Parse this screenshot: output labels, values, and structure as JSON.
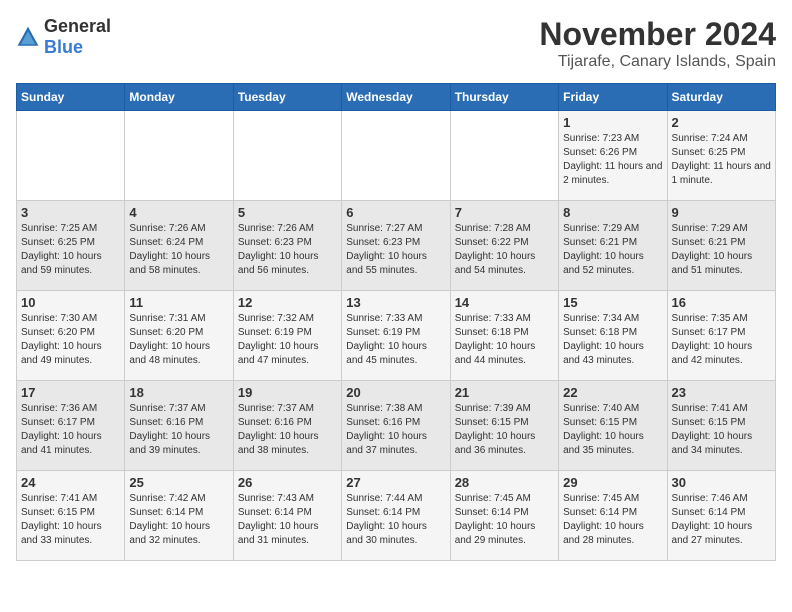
{
  "header": {
    "logo_general": "General",
    "logo_blue": "Blue",
    "month": "November 2024",
    "location": "Tijarafe, Canary Islands, Spain"
  },
  "weekdays": [
    "Sunday",
    "Monday",
    "Tuesday",
    "Wednesday",
    "Thursday",
    "Friday",
    "Saturday"
  ],
  "weeks": [
    [
      {
        "day": "",
        "info": ""
      },
      {
        "day": "",
        "info": ""
      },
      {
        "day": "",
        "info": ""
      },
      {
        "day": "",
        "info": ""
      },
      {
        "day": "",
        "info": ""
      },
      {
        "day": "1",
        "info": "Sunrise: 7:23 AM\nSunset: 6:26 PM\nDaylight: 11 hours and 2 minutes."
      },
      {
        "day": "2",
        "info": "Sunrise: 7:24 AM\nSunset: 6:25 PM\nDaylight: 11 hours and 1 minute."
      }
    ],
    [
      {
        "day": "3",
        "info": "Sunrise: 7:25 AM\nSunset: 6:25 PM\nDaylight: 10 hours and 59 minutes."
      },
      {
        "day": "4",
        "info": "Sunrise: 7:26 AM\nSunset: 6:24 PM\nDaylight: 10 hours and 58 minutes."
      },
      {
        "day": "5",
        "info": "Sunrise: 7:26 AM\nSunset: 6:23 PM\nDaylight: 10 hours and 56 minutes."
      },
      {
        "day": "6",
        "info": "Sunrise: 7:27 AM\nSunset: 6:23 PM\nDaylight: 10 hours and 55 minutes."
      },
      {
        "day": "7",
        "info": "Sunrise: 7:28 AM\nSunset: 6:22 PM\nDaylight: 10 hours and 54 minutes."
      },
      {
        "day": "8",
        "info": "Sunrise: 7:29 AM\nSunset: 6:21 PM\nDaylight: 10 hours and 52 minutes."
      },
      {
        "day": "9",
        "info": "Sunrise: 7:29 AM\nSunset: 6:21 PM\nDaylight: 10 hours and 51 minutes."
      }
    ],
    [
      {
        "day": "10",
        "info": "Sunrise: 7:30 AM\nSunset: 6:20 PM\nDaylight: 10 hours and 49 minutes."
      },
      {
        "day": "11",
        "info": "Sunrise: 7:31 AM\nSunset: 6:20 PM\nDaylight: 10 hours and 48 minutes."
      },
      {
        "day": "12",
        "info": "Sunrise: 7:32 AM\nSunset: 6:19 PM\nDaylight: 10 hours and 47 minutes."
      },
      {
        "day": "13",
        "info": "Sunrise: 7:33 AM\nSunset: 6:19 PM\nDaylight: 10 hours and 45 minutes."
      },
      {
        "day": "14",
        "info": "Sunrise: 7:33 AM\nSunset: 6:18 PM\nDaylight: 10 hours and 44 minutes."
      },
      {
        "day": "15",
        "info": "Sunrise: 7:34 AM\nSunset: 6:18 PM\nDaylight: 10 hours and 43 minutes."
      },
      {
        "day": "16",
        "info": "Sunrise: 7:35 AM\nSunset: 6:17 PM\nDaylight: 10 hours and 42 minutes."
      }
    ],
    [
      {
        "day": "17",
        "info": "Sunrise: 7:36 AM\nSunset: 6:17 PM\nDaylight: 10 hours and 41 minutes."
      },
      {
        "day": "18",
        "info": "Sunrise: 7:37 AM\nSunset: 6:16 PM\nDaylight: 10 hours and 39 minutes."
      },
      {
        "day": "19",
        "info": "Sunrise: 7:37 AM\nSunset: 6:16 PM\nDaylight: 10 hours and 38 minutes."
      },
      {
        "day": "20",
        "info": "Sunrise: 7:38 AM\nSunset: 6:16 PM\nDaylight: 10 hours and 37 minutes."
      },
      {
        "day": "21",
        "info": "Sunrise: 7:39 AM\nSunset: 6:15 PM\nDaylight: 10 hours and 36 minutes."
      },
      {
        "day": "22",
        "info": "Sunrise: 7:40 AM\nSunset: 6:15 PM\nDaylight: 10 hours and 35 minutes."
      },
      {
        "day": "23",
        "info": "Sunrise: 7:41 AM\nSunset: 6:15 PM\nDaylight: 10 hours and 34 minutes."
      }
    ],
    [
      {
        "day": "24",
        "info": "Sunrise: 7:41 AM\nSunset: 6:15 PM\nDaylight: 10 hours and 33 minutes."
      },
      {
        "day": "25",
        "info": "Sunrise: 7:42 AM\nSunset: 6:14 PM\nDaylight: 10 hours and 32 minutes."
      },
      {
        "day": "26",
        "info": "Sunrise: 7:43 AM\nSunset: 6:14 PM\nDaylight: 10 hours and 31 minutes."
      },
      {
        "day": "27",
        "info": "Sunrise: 7:44 AM\nSunset: 6:14 PM\nDaylight: 10 hours and 30 minutes."
      },
      {
        "day": "28",
        "info": "Sunrise: 7:45 AM\nSunset: 6:14 PM\nDaylight: 10 hours and 29 minutes."
      },
      {
        "day": "29",
        "info": "Sunrise: 7:45 AM\nSunset: 6:14 PM\nDaylight: 10 hours and 28 minutes."
      },
      {
        "day": "30",
        "info": "Sunrise: 7:46 AM\nSunset: 6:14 PM\nDaylight: 10 hours and 27 minutes."
      }
    ]
  ]
}
